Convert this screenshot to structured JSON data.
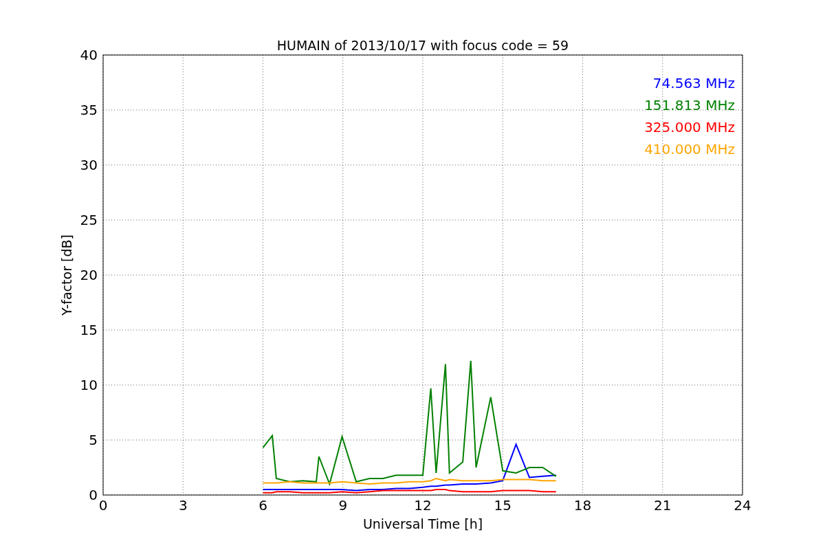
{
  "figure": {
    "chart_data": {
      "type": "line",
      "title": "HUMAIN of 2013/10/17 with focus code = 59",
      "xlabel": "Universal Time [h]",
      "ylabel": "Y-factor [dB]",
      "x": [
        6,
        6.35,
        6.5,
        7,
        7.5,
        8,
        8.1,
        8.5,
        8.97,
        9.5,
        10,
        10.5,
        11,
        11.5,
        12,
        12.3,
        12.5,
        12.85,
        13,
        13.5,
        13.8,
        14,
        14.55,
        15,
        15.5,
        16,
        16.5,
        17
      ],
      "series": [
        {
          "name": "74.563 MHz",
          "color": "#0000ff",
          "values": [
            0.5,
            0.5,
            0.5,
            0.5,
            0.5,
            0.5,
            0.5,
            0.5,
            0.5,
            0.4,
            0.5,
            0.5,
            0.6,
            0.6,
            0.7,
            0.8,
            0.8,
            0.9,
            0.9,
            1.0,
            1.0,
            1.0,
            1.1,
            1.3,
            4.6,
            1.6,
            1.7,
            1.8
          ]
        },
        {
          "name": "151.813 MHz",
          "color": "#008000",
          "values": [
            4.3,
            5.4,
            1.5,
            1.2,
            1.3,
            1.2,
            3.5,
            1.0,
            5.3,
            1.2,
            1.5,
            1.5,
            1.8,
            1.8,
            1.8,
            9.7,
            2.0,
            11.9,
            2.0,
            3.0,
            12.2,
            2.5,
            8.9,
            2.2,
            2.0,
            2.5,
            2.5,
            1.7
          ]
        },
        {
          "name": "325.000 MHz",
          "color": "#ff0000",
          "values": [
            0.2,
            0.2,
            0.3,
            0.3,
            0.2,
            0.2,
            0.2,
            0.2,
            0.3,
            0.2,
            0.3,
            0.4,
            0.4,
            0.4,
            0.4,
            0.4,
            0.5,
            0.5,
            0.4,
            0.3,
            0.3,
            0.3,
            0.3,
            0.4,
            0.4,
            0.4,
            0.3,
            0.3
          ]
        },
        {
          "name": "410.000 MHz",
          "color": "#ffa500",
          "values": [
            1.1,
            1.1,
            1.1,
            1.2,
            1.1,
            1.1,
            1.1,
            1.1,
            1.2,
            1.1,
            1.0,
            1.1,
            1.1,
            1.2,
            1.2,
            1.3,
            1.5,
            1.3,
            1.4,
            1.3,
            1.3,
            1.3,
            1.3,
            1.4,
            1.4,
            1.4,
            1.3,
            1.3
          ]
        }
      ],
      "xlim": [
        0,
        24
      ],
      "ylim": [
        0,
        40
      ],
      "xticks": [
        0,
        3,
        6,
        9,
        12,
        15,
        18,
        21,
        24
      ],
      "yticks": [
        0,
        5,
        10,
        15,
        20,
        25,
        30,
        35,
        40
      ],
      "grid": true
    }
  }
}
